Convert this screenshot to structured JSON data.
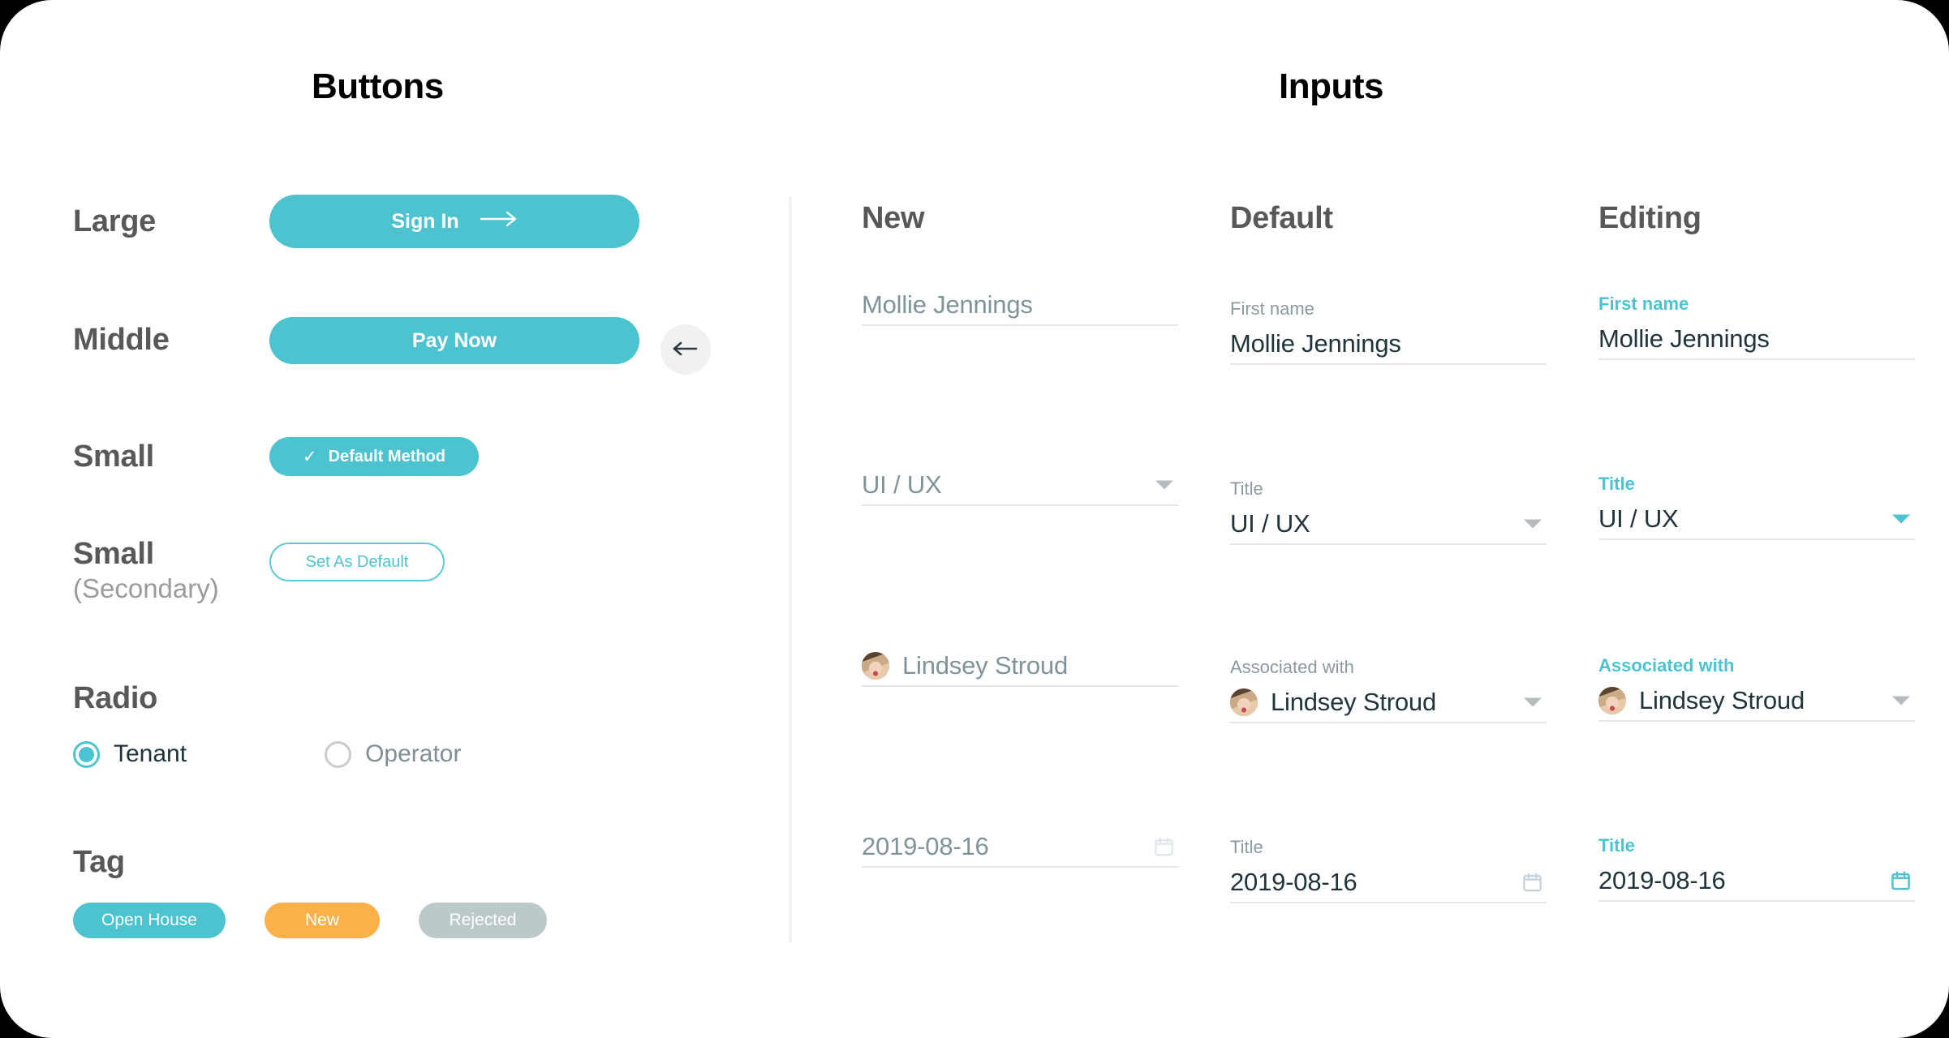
{
  "sections": {
    "buttons_title": "Buttons",
    "inputs_title": "Inputs"
  },
  "colors": {
    "accent": "#4ec3d0",
    "accent_border": "#5ccbd6",
    "tag_new": "#fbb04a",
    "tag_rejected": "#bcc9c9",
    "label_gray": "#58585a",
    "muted_gray": "#9b9b9b",
    "placeholder": "#7f9499",
    "value_dark": "#20343c",
    "field_label": "#8a9a9e",
    "underline": "#e2e7ea",
    "divider": "#f0f4f4",
    "back_button_bg": "#f1f1f1"
  },
  "buttons": {
    "rows": [
      {
        "label": "Large",
        "sub": ""
      },
      {
        "label": "Middle",
        "sub": ""
      },
      {
        "label": "Small",
        "sub": ""
      },
      {
        "label": "Small",
        "sub": "(Secondary)"
      }
    ],
    "large": {
      "label": "Sign In",
      "icon": "arrow-right-icon"
    },
    "middle": {
      "label": "Pay Now"
    },
    "back": {
      "icon": "arrow-left-icon"
    },
    "small": {
      "label": "Default Method",
      "icon": "check-icon"
    },
    "small_secondary": {
      "label": "Set As Default"
    }
  },
  "radio": {
    "heading": "Radio",
    "options": [
      {
        "label": "Tenant",
        "checked": true
      },
      {
        "label": "Operator",
        "checked": false
      }
    ]
  },
  "tag": {
    "heading": "Tag",
    "items": [
      {
        "label": "Open House",
        "color": "#4ec3d0"
      },
      {
        "label": "New",
        "color": "#fbb04a"
      },
      {
        "label": "Rejected",
        "color": "#bcc9c9"
      }
    ]
  },
  "inputs": {
    "columns": [
      {
        "title": "New",
        "fields": [
          {
            "label": "",
            "value": "Mollie Jennings",
            "type": "text",
            "state": "placeholder"
          },
          {
            "label": "",
            "value": "UI / UX",
            "type": "select",
            "state": "placeholder"
          },
          {
            "label": "",
            "value": "Lindsey Stroud",
            "type": "avatar-select",
            "state": "placeholder",
            "avatar": "avatar-lindsey-stroud"
          },
          {
            "label": "",
            "value": "2019-08-16",
            "type": "date",
            "state": "placeholder"
          }
        ]
      },
      {
        "title": "Default",
        "fields": [
          {
            "label": "First name",
            "value": "Mollie Jennings",
            "type": "text",
            "state": "default"
          },
          {
            "label": "Title",
            "value": "UI / UX",
            "type": "select",
            "state": "default"
          },
          {
            "label": "Associated with",
            "value": "Lindsey Stroud",
            "type": "avatar-select",
            "state": "default",
            "avatar": "avatar-lindsey-stroud"
          },
          {
            "label": "Title",
            "value": "2019-08-16",
            "type": "date",
            "state": "default"
          }
        ]
      },
      {
        "title": "Editing",
        "fields": [
          {
            "label": "First name",
            "value": "Mollie Jennings",
            "type": "text",
            "state": "editing"
          },
          {
            "label": "Title",
            "value": "UI / UX",
            "type": "select",
            "state": "editing"
          },
          {
            "label": "Associated with",
            "value": "Lindsey Stroud",
            "type": "avatar-select",
            "state": "editing",
            "avatar": "avatar-lindsey-stroud"
          },
          {
            "label": "Title",
            "value": "2019-08-16",
            "type": "date",
            "state": "editing"
          }
        ]
      }
    ]
  }
}
